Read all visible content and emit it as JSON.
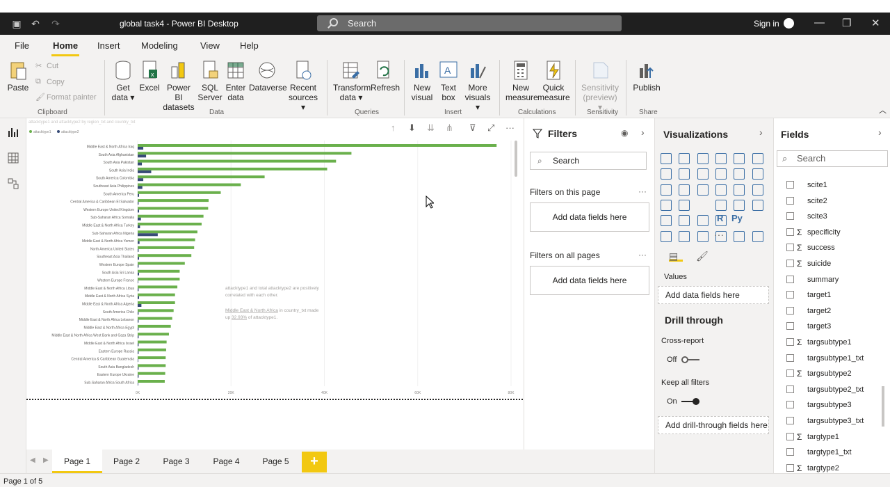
{
  "window": {
    "title": "global task4 - Power BI Desktop",
    "search_placeholder": "Search",
    "signin": "Sign in"
  },
  "menu": [
    "File",
    "Home",
    "Insert",
    "Modeling",
    "View",
    "Help"
  ],
  "ribbon": {
    "paste": "Paste",
    "cut": "Cut",
    "copy": "Copy",
    "format_painter": "Format painter",
    "get_data": [
      "Get",
      "data ▾"
    ],
    "excel": "Excel",
    "pbi_datasets": [
      "Power BI",
      "datasets"
    ],
    "sql_server": [
      "SQL",
      "Server"
    ],
    "enter_data": [
      "Enter",
      "data"
    ],
    "dataverse": "Dataverse",
    "recent_sources": [
      "Recent",
      "sources ▾"
    ],
    "transform_data": [
      "Transform",
      "data ▾"
    ],
    "refresh": "Refresh",
    "new_visual": [
      "New",
      "visual"
    ],
    "text_box": [
      "Text",
      "box"
    ],
    "more_visuals": [
      "More",
      "visuals ▾"
    ],
    "new_measure": [
      "New",
      "measure"
    ],
    "quick_measure": [
      "Quick",
      "measure"
    ],
    "sensitivity": [
      "Sensitivity",
      "(preview) ▾"
    ],
    "publish": "Publish",
    "groups": [
      "Clipboard",
      "Data",
      "Queries",
      "Insert",
      "Calculations",
      "Sensitivity",
      "Share"
    ]
  },
  "chart_data": {
    "type": "bar",
    "title": "attacktype1 and attacktype2 by region_txt and country_txt",
    "legend": [
      "attacktype1",
      "attacktype2"
    ],
    "colors": {
      "attacktype1": "#6ab04c",
      "attacktype2": "#374b77"
    },
    "categories": [
      "Middle East & North Africa Iraq",
      "South Asia Afghanistan",
      "South Asia Pakistan",
      "South Asia India",
      "South America Colombia",
      "Southeast Asia Philippines",
      "South America Peru",
      "Central America & Caribbean El Salvador",
      "Western Europe United Kingdom",
      "Sub-Saharan Africa Somalia",
      "Middle East & North Africa Turkey",
      "Sub-Saharan Africa Nigeria",
      "Middle East & North Africa Yemen",
      "North America United States",
      "Southeast Asia Thailand",
      "Western Europe Spain",
      "South Asia Sri Lanka",
      "Western Europe France",
      "Middle East & North Africa Libya",
      "Middle East & North Africa Syria",
      "Middle East & North Africa Algeria",
      "South America Chile",
      "Middle East & North Africa Lebanon",
      "Middle East & North Africa Egypt",
      "Middle East & North Africa West Bank and Gaza Strip",
      "Middle East & North Africa Israel",
      "Eastern Europe Russia",
      "Central America & Caribbean Guatemala",
      "South Asia Bangladesh",
      "Eastern Europe Ukraine",
      "Sub-Saharan Africa South Africa"
    ],
    "series": [
      {
        "name": "attacktype1",
        "values": [
          76900,
          45800,
          42500,
          40600,
          27200,
          22100,
          17800,
          15200,
          15100,
          14100,
          13700,
          12800,
          12300,
          12100,
          11500,
          10100,
          9000,
          9000,
          8500,
          8000,
          8000,
          7700,
          7400,
          7100,
          6700,
          6200,
          6100,
          6000,
          6000,
          5900,
          5800
        ]
      },
      {
        "name": "attacktype2",
        "values": [
          1200,
          1800,
          900,
          2900,
          1200,
          1000,
          300,
          200,
          300,
          700,
          500,
          4300,
          400,
          200,
          300,
          200,
          300,
          100,
          200,
          300,
          800,
          200,
          200,
          200,
          200,
          200,
          200,
          100,
          200,
          200,
          100
        ]
      }
    ],
    "xticks": [
      "0K",
      "20K",
      "40K",
      "60K",
      "80K"
    ],
    "xlim": [
      0,
      80000
    ],
    "annotation": {
      "line1": "attacktype1 and total attacktype2 are positively",
      "line2": "correlated with each other.",
      "line3_link": "Middle East & North Africa",
      "line3_rest": " in country_txt  made",
      "line4_pre": "up ",
      "line4_link": "32.93%",
      "line4_rest": " of attacktype1."
    }
  },
  "pages": [
    "Page 1",
    "Page 2",
    "Page 3",
    "Page 4",
    "Page 5"
  ],
  "add_page": "+",
  "status": "Page 1 of 5",
  "filters": {
    "title": "Filters",
    "search": "Search",
    "on_this_page": "Filters on this page",
    "on_all_pages": "Filters on all pages",
    "add_fields": "Add data fields here",
    "dots": "···"
  },
  "visualizations": {
    "title": "Visualizations",
    "values_label": "Values",
    "add_fields": "Add data fields here",
    "drill_through": "Drill through",
    "cross_report": "Cross-report",
    "off": "Off",
    "keep_filters": "Keep all filters",
    "on": "On",
    "add_drill": "Add drill-through fields here",
    "r_label": "R",
    "py_label": "Py",
    "more": "···"
  },
  "fields": {
    "title": "Fields",
    "search": "Search",
    "items": [
      {
        "name": "scite1",
        "sigma": false
      },
      {
        "name": "scite2",
        "sigma": false
      },
      {
        "name": "scite3",
        "sigma": false
      },
      {
        "name": "specificity",
        "sigma": true
      },
      {
        "name": "success",
        "sigma": true
      },
      {
        "name": "suicide",
        "sigma": true
      },
      {
        "name": "summary",
        "sigma": false
      },
      {
        "name": "target1",
        "sigma": false
      },
      {
        "name": "target2",
        "sigma": false
      },
      {
        "name": "target3",
        "sigma": false
      },
      {
        "name": "targsubtype1",
        "sigma": true
      },
      {
        "name": "targsubtype1_txt",
        "sigma": false
      },
      {
        "name": "targsubtype2",
        "sigma": true
      },
      {
        "name": "targsubtype2_txt",
        "sigma": false
      },
      {
        "name": "targsubtype3",
        "sigma": false
      },
      {
        "name": "targsubtype3_txt",
        "sigma": false
      },
      {
        "name": "targtype1",
        "sigma": true
      },
      {
        "name": "targtype1_txt",
        "sigma": false
      },
      {
        "name": "targtype2",
        "sigma": true
      }
    ]
  }
}
